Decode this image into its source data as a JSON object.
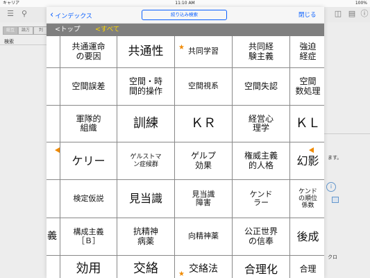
{
  "status": {
    "carrier": "キャリア",
    "time": "11:10 AM",
    "battery": "100%"
  },
  "background": {
    "segments": [
      "総互",
      "論方",
      "判"
    ],
    "search_label": "検索",
    "right_text_1": "ます。",
    "right_text_2": "クロ"
  },
  "nav": {
    "back_label": "インデックス",
    "filter_label": "絞り込み検索",
    "close_label": "閉じる"
  },
  "breadcrumb": {
    "top": "<トップ",
    "all": "<すべて"
  },
  "accent_color": "#0a60ff",
  "highlight_color": "#ffd800",
  "mark_color": "#f08a00",
  "grid": [
    [
      "",
      "共通運命\nの要因",
      "共通性",
      "共同学習",
      "共同経\n験主義",
      "強迫\n経症"
    ],
    [
      "",
      "空間誤差",
      "空間・時\n間的操作",
      "空間視系",
      "空間失認",
      "空間\n数処理"
    ],
    [
      "",
      "軍隊的\n組織",
      "訓練",
      "ＫＲ",
      "経営心\n理学",
      "ＫＬ"
    ],
    [
      "",
      "ケリー",
      "ゲルストマ\nン症候群",
      "ゲルプ\n効果",
      "権威主義\n的人格",
      "幻影"
    ],
    [
      "",
      "検定仮説",
      "見当識",
      "見当識\n障害",
      "ケンド\nラー",
      "ケンド\nの順位\n係数"
    ],
    [
      "義",
      "構成主義\n［Ｂ］",
      "抗精神\n病薬",
      "向精神薬",
      "公正世界\nの信奉",
      "後成"
    ],
    [
      "",
      "効用",
      "交絡",
      "交絡法",
      "合理化",
      "合理"
    ]
  ]
}
